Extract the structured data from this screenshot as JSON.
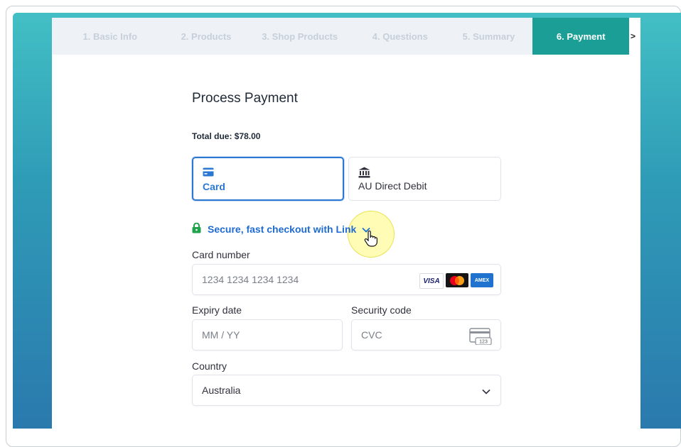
{
  "steps": [
    {
      "label": "1. Basic Info"
    },
    {
      "label": "2. Products"
    },
    {
      "label": "3. Shop Products"
    },
    {
      "label": "4. Questions"
    },
    {
      "label": "5. Summary"
    },
    {
      "label": "6. Payment"
    }
  ],
  "steps_more": ">",
  "active_step": "6. Payment",
  "page": {
    "title": "Process Payment",
    "total_due": "Total due: $78.00"
  },
  "payment_methods": [
    {
      "label": "Card",
      "icon": "credit-card-icon",
      "selected": true
    },
    {
      "label": "AU Direct Debit",
      "icon": "bank-icon",
      "selected": false
    }
  ],
  "link_checkout": {
    "label": "Secure, fast checkout with Link",
    "icon": "lock-icon"
  },
  "card_number": {
    "label": "Card number",
    "placeholder": "1234 1234 1234 1234",
    "brands": [
      "VISA",
      "mastercard",
      "AMEX"
    ]
  },
  "expiry": {
    "label": "Expiry date",
    "placeholder": "MM / YY"
  },
  "security_code": {
    "label": "Security code",
    "placeholder": "CVC",
    "icon_text": "123"
  },
  "country": {
    "label": "Country",
    "value": "Australia"
  },
  "colors": {
    "accent_teal": "#1a9e96",
    "link_blue": "#1f6bd0",
    "selected_blue": "#2a78d1",
    "lock_green": "#1fa34a"
  }
}
